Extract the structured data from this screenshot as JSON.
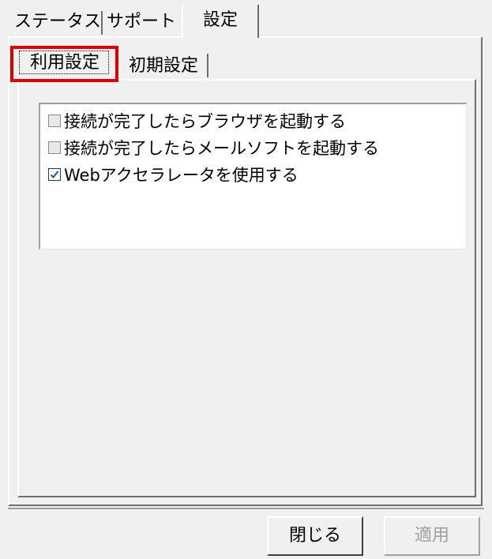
{
  "top_tabs": [
    {
      "label": "ステータス",
      "active": false
    },
    {
      "label": "サポート",
      "active": false
    },
    {
      "label": "設定",
      "active": true
    }
  ],
  "inner_tabs": [
    {
      "label": "利用設定",
      "active": true
    },
    {
      "label": "初期設定",
      "active": false
    }
  ],
  "options": [
    {
      "label": "接続が完了したらブラウザを起動する",
      "checked": false
    },
    {
      "label": "接続が完了したらメールソフトを起動する",
      "checked": false
    },
    {
      "label": "Webアクセラレータを使用する",
      "checked": true
    }
  ],
  "buttons": {
    "close_label": "閉じる",
    "apply_label": "適用",
    "apply_enabled": false
  },
  "colors": {
    "highlight": "#e00000",
    "checkmark": "#2a5fb0",
    "disabled_text": "#a0a0a0"
  }
}
